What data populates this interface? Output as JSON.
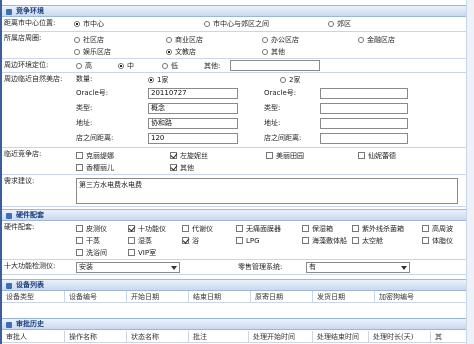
{
  "sections": {
    "competition": "竞争环境",
    "hardware": "硬件配套",
    "devices": "设备列表",
    "history": "审批历史"
  },
  "city_center": {
    "label": "距离市中心位置:",
    "options": [
      "市中心",
      "市中心与郊区之间",
      "郊区"
    ],
    "selected": 0
  },
  "store_area": {
    "label": "所属店周圈:",
    "row1": [
      "社区店",
      "商业区店",
      "办公区店",
      "金融区店"
    ],
    "row2": [
      "娱乐区店",
      "文教店",
      "其他"
    ],
    "selected_row2": 1
  },
  "surroundings": {
    "label": "周边环境定位:",
    "options": [
      "高",
      "中",
      "低"
    ],
    "selected": 1,
    "other_label": "其他:"
  },
  "nearby": {
    "label": "周边临近自然美店:",
    "qty_label": "数量:",
    "qty_options": [
      "1家",
      "2家"
    ],
    "qty_selected": 0,
    "left": {
      "oracle_label": "Oracle号:",
      "oracle_value": "20110727",
      "type_label": "类型:",
      "type_value": "概念",
      "addr_label": "地址:",
      "addr_value": "协和路",
      "dist_label": "店之间距离:",
      "dist_value": "120"
    },
    "right": {
      "oracle_label": "Oracle号:",
      "type_label": "类型:",
      "addr_label": "地址:",
      "dist_label": "店之间距离:"
    }
  },
  "competitors": {
    "label": "临近竞争店:",
    "row1": [
      "克丽缇娜",
      "左旋妮丝",
      "美丽田园",
      "仙妮蕾德"
    ],
    "row2": [
      "香樱丽儿",
      "其他"
    ],
    "checked_row1": [
      false,
      true,
      false,
      false
    ],
    "checked_row2": [
      false,
      true
    ]
  },
  "suggestion": {
    "label": "需求建议:",
    "value": "第三方水电费水电费"
  },
  "hardware": {
    "label": "硬件配套:",
    "row1": [
      "皮测仪",
      "十功能仪",
      "代谢仪",
      "无痛面膜器",
      "保湿箱",
      "紫外线杀菌箱",
      "高周波"
    ],
    "row2": [
      "干蒸",
      "湿蒸",
      "浴",
      "LPG",
      "海藻敷体船",
      "太空舱",
      "体脂仪"
    ],
    "row3": [
      "洗浴间",
      "VIP室"
    ],
    "checked_row1": [
      false,
      true,
      false,
      false,
      false,
      false,
      false
    ],
    "checked_row2": [
      false,
      false,
      true,
      false,
      false,
      false,
      false
    ],
    "checked_row3": [
      false,
      false
    ]
  },
  "selects": {
    "ten_func_label": "十大功能检测仪:",
    "ten_func_value": "安装",
    "mgmt_label": "零售管理系统:",
    "mgmt_value": "有"
  },
  "device_table": {
    "headers": [
      "设备类型",
      "设备编号",
      "开始日期",
      "结束日期",
      "原寄日期",
      "发货日期",
      "加密狗编号"
    ]
  },
  "history_table": {
    "headers": [
      "审批人",
      "操作名称",
      "状态名称",
      "批注",
      "处理开始时间",
      "处理结束时间",
      "处理时长(天)",
      "其"
    ]
  }
}
